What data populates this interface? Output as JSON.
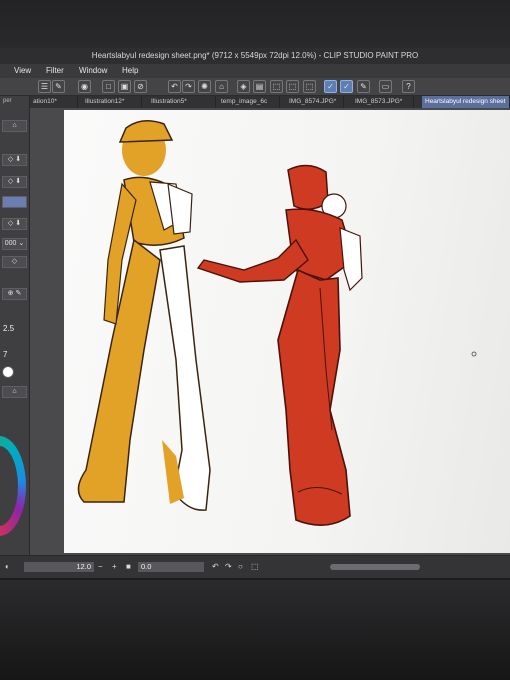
{
  "window": {
    "title": "Heartslabyul redesign sheet.png* (9712 x 5549px 72dpi 12.0%) - CLIP STUDIO PAINT PRO"
  },
  "menu": {
    "items": [
      "View",
      "Filter",
      "Window",
      "Help"
    ]
  },
  "tabs": [
    {
      "label": "ation10*"
    },
    {
      "label": "Illustration12*"
    },
    {
      "label": "Illustration5*"
    },
    {
      "label": "temp_image_6c"
    },
    {
      "label": "IMG_8574.JPG*"
    },
    {
      "label": "IMG_8573.JPG*"
    },
    {
      "label": "Heartslabyul redesign sheet"
    }
  ],
  "left_panel": {
    "brush_size": "2.5",
    "brush_density": "7",
    "partial_label": "per",
    "field_value": "000"
  },
  "status": {
    "zoom": "12.0",
    "angle": "0.0"
  },
  "colors": {
    "yellow_figure": "#e2a227",
    "red_figure": "#cf3a22",
    "paper": "#f6f6f4",
    "ui_dark": "#3b3b3e",
    "active_tab": "#5a6f9c"
  }
}
